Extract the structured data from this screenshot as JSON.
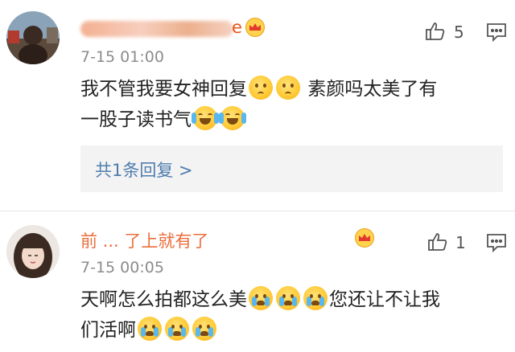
{
  "comments": [
    {
      "username_suffix": "e",
      "time": "7-15 01:00",
      "text_line1": "我不管我要女神回复",
      "text_line1b": "素颜吗太美了有",
      "text_line2": "一股子读书气",
      "reply_link": "共1条回复 >",
      "like_count": "5",
      "icons": [
        "avatar",
        "crown-icon",
        "thumbs-up-icon",
        "comment-icon",
        "sad-face-emoji",
        "laugh-cry-emoji"
      ]
    },
    {
      "username": "前 ... 了上就有了",
      "time": "7-15 00:05",
      "text_line1": "天啊怎么拍都这么美",
      "text_line1b": "您还让不让我",
      "text_line2": "们活啊",
      "like_count": "1",
      "icons": [
        "avatar",
        "crown-icon",
        "thumbs-up-icon",
        "comment-icon",
        "crying-emoji"
      ]
    }
  ],
  "colors": {
    "username": "#e8541a",
    "link": "#4f7cae",
    "time": "#8c8c8c",
    "reply_bg": "#f3f3f3"
  }
}
